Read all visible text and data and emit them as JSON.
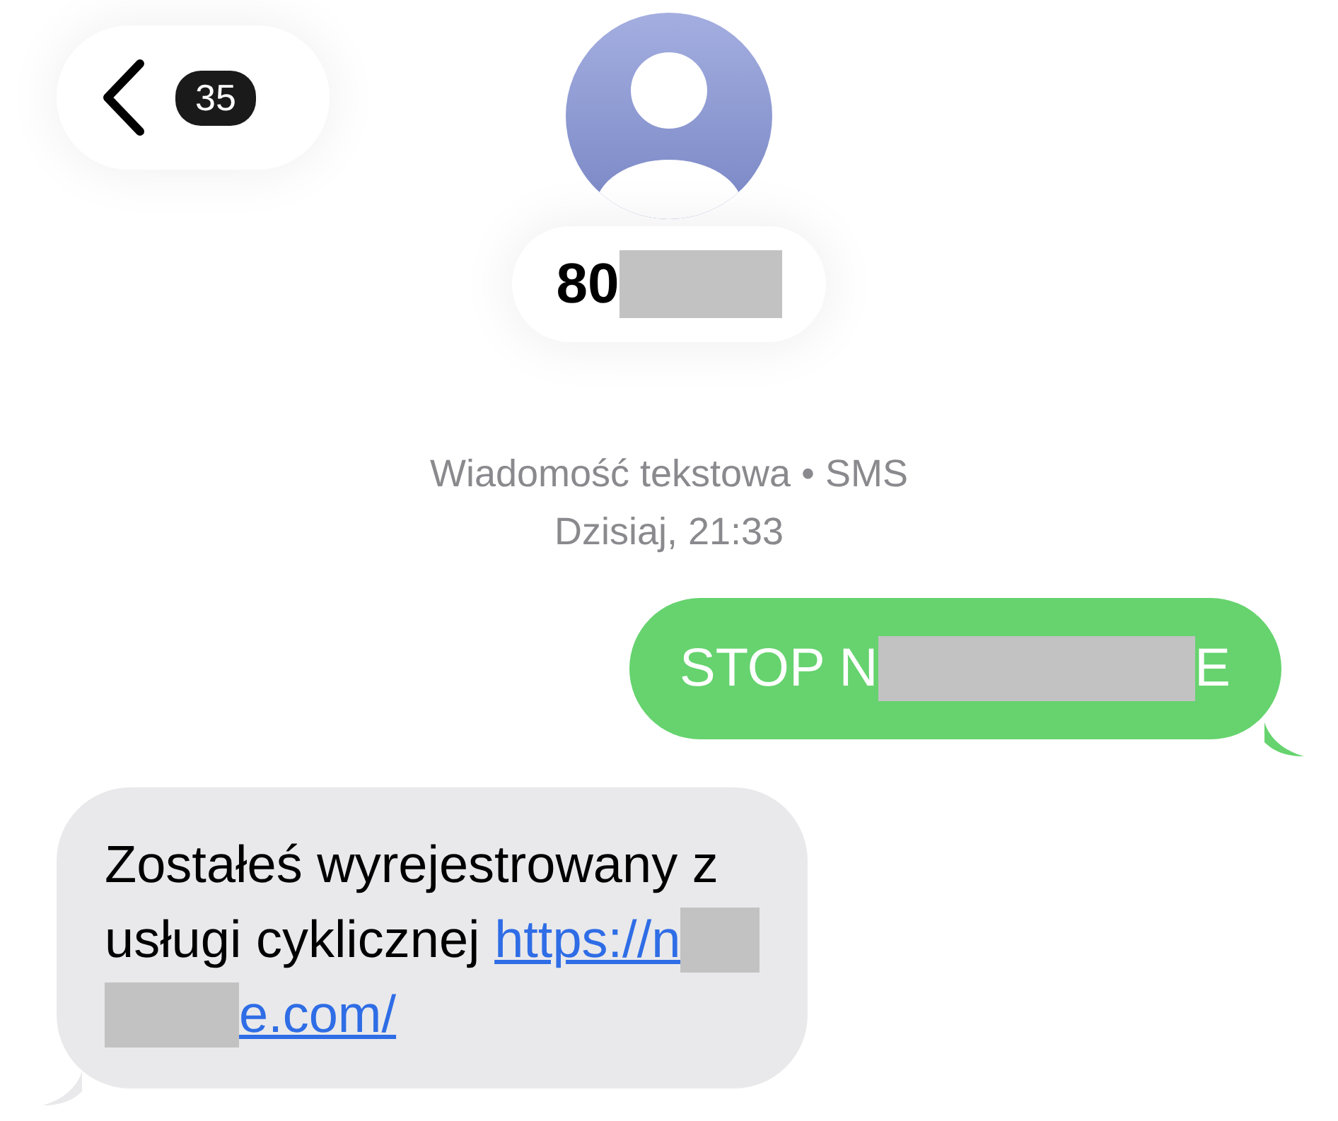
{
  "header": {
    "back": {
      "badge": "35"
    },
    "contact": {
      "segments": [
        {
          "kind": "text",
          "text": "80"
        },
        {
          "kind": "redacted"
        }
      ]
    }
  },
  "meta": {
    "service": "Wiadomość tekstowa • SMS",
    "timestamp": "Dzisiaj, 21:33"
  },
  "messages": [
    {
      "kind": "sent",
      "lines": [
        [
          {
            "kind": "text",
            "text": "STOP N"
          },
          {
            "kind": "redacted"
          },
          {
            "kind": "text",
            "text": "E"
          }
        ]
      ]
    },
    {
      "kind": "received",
      "lines": [
        [
          {
            "kind": "text",
            "text": "Zostałeś wyrejestrowany z"
          }
        ],
        [
          {
            "kind": "text",
            "text": "usługi cyklicznej "
          },
          {
            "kind": "link",
            "text": "https://n"
          },
          {
            "kind": "redacted"
          }
        ],
        [
          {
            "kind": "redacted"
          },
          {
            "kind": "link",
            "text": "e.com/"
          }
        ]
      ]
    }
  ]
}
